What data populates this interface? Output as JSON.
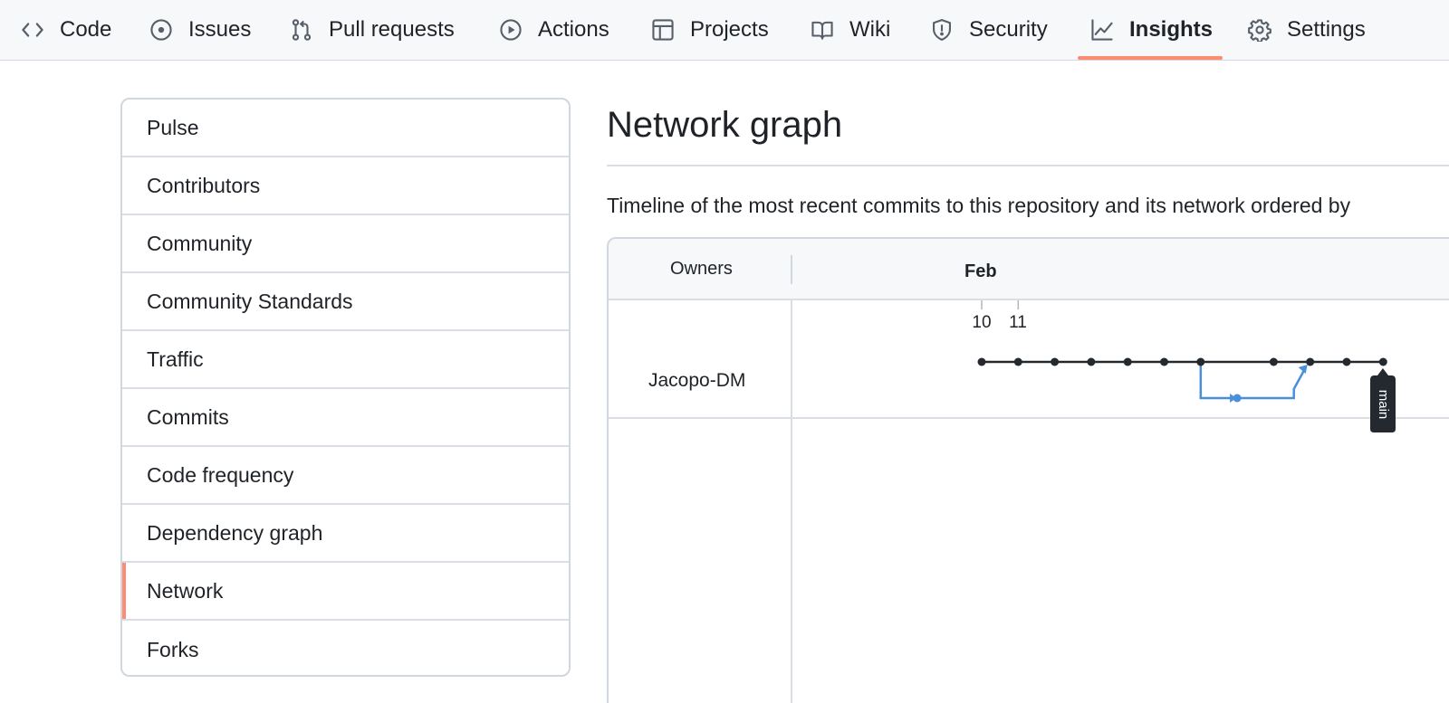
{
  "nav": {
    "tabs": [
      {
        "label": "Code",
        "icon": "code-icon"
      },
      {
        "label": "Issues",
        "icon": "issue-icon"
      },
      {
        "label": "Pull requests",
        "icon": "pull-request-icon"
      },
      {
        "label": "Actions",
        "icon": "play-icon"
      },
      {
        "label": "Projects",
        "icon": "table-icon"
      },
      {
        "label": "Wiki",
        "icon": "book-icon"
      },
      {
        "label": "Security",
        "icon": "shield-icon"
      },
      {
        "label": "Insights",
        "icon": "graph-icon",
        "active": true
      },
      {
        "label": "Settings",
        "icon": "gear-icon"
      }
    ]
  },
  "sidebar": {
    "items": [
      {
        "label": "Pulse"
      },
      {
        "label": "Contributors"
      },
      {
        "label": "Community"
      },
      {
        "label": "Community Standards"
      },
      {
        "label": "Traffic"
      },
      {
        "label": "Commits"
      },
      {
        "label": "Code frequency"
      },
      {
        "label": "Dependency graph"
      },
      {
        "label": "Network",
        "active": true
      },
      {
        "label": "Forks"
      }
    ]
  },
  "main": {
    "title": "Network graph",
    "description": "Timeline of the most recent commits to this repository and its network ordered by"
  },
  "network": {
    "owners_header": "Owners",
    "month": "Feb",
    "day_labels": [
      "10",
      "11"
    ],
    "owner": "Jacopo-DM",
    "branch_label": "main",
    "main_commit_count": 12,
    "branch_commit_count": 1,
    "colors": {
      "main": "#24292f",
      "branch": "#4a90d9",
      "accent": "#fd8c73"
    }
  }
}
